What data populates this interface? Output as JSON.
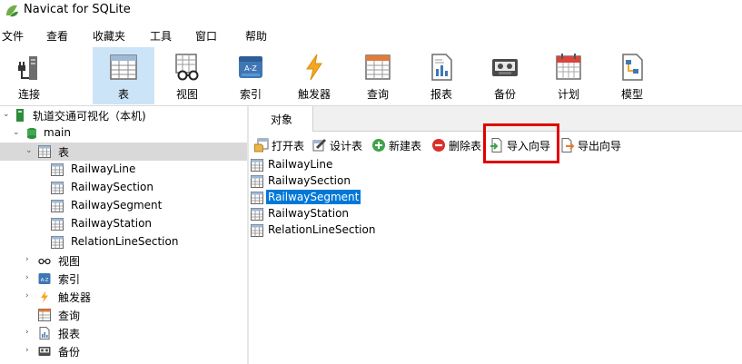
{
  "app": {
    "title": "Navicat for SQLite"
  },
  "menu": [
    "文件",
    "查看",
    "收藏夹",
    "工具",
    "窗口",
    "帮助"
  ],
  "toolbar": {
    "items": [
      {
        "label": "连接",
        "icon": "connection-icon"
      },
      {
        "label": "表",
        "icon": "table-icon",
        "selected": true
      },
      {
        "label": "视图",
        "icon": "view-icon"
      },
      {
        "label": "索引",
        "icon": "index-icon"
      },
      {
        "label": "触发器",
        "icon": "trigger-icon"
      },
      {
        "label": "查询",
        "icon": "query-icon"
      },
      {
        "label": "报表",
        "icon": "report-icon"
      },
      {
        "label": "备份",
        "icon": "backup-icon"
      },
      {
        "label": "计划",
        "icon": "schedule-icon"
      },
      {
        "label": "模型",
        "icon": "model-icon"
      }
    ]
  },
  "tree": {
    "connection": "轨道交通可视化（本机)",
    "database": "main",
    "tables_label": "表",
    "tables": [
      "RailwayLine",
      "RailwaySection",
      "RailwaySegment",
      "RailwayStation",
      "RelationLineSection"
    ],
    "views_label": "视图",
    "indexes_label": "索引",
    "triggers_label": "触发器",
    "queries_label": "查询",
    "reports_label": "报表",
    "backups_label": "备份"
  },
  "tabs": {
    "objects": "对象"
  },
  "objbar": {
    "open": "打开表",
    "design": "设计表",
    "new": "新建表",
    "delete": "删除表",
    "import": "导入向导",
    "export": "导出向导"
  },
  "objects": {
    "items": [
      "RailwayLine",
      "RailwaySection",
      "RailwaySegment",
      "RailwayStation",
      "RelationLineSection"
    ],
    "selected": "RailwaySegment"
  },
  "colors": {
    "accent": "#0078d7",
    "selected_tool": "#cce4f7",
    "highlight_box": "#e00000"
  }
}
